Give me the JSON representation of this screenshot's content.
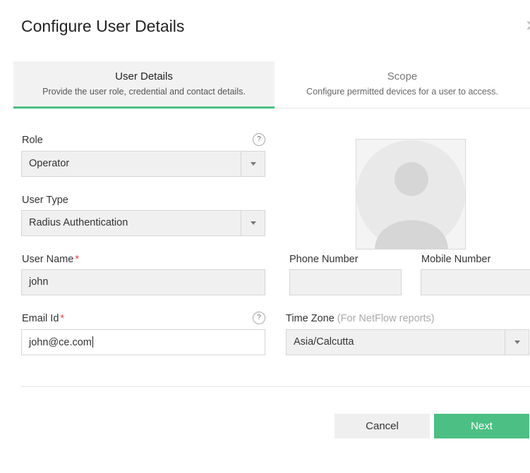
{
  "dialog": {
    "title": "Configure User Details"
  },
  "tabs": [
    {
      "title": "User Details",
      "description": "Provide the user role, credential and contact details.",
      "active": true
    },
    {
      "title": "Scope",
      "description": "Configure permitted devices for a user to access.",
      "active": false
    }
  ],
  "form": {
    "role": {
      "label": "Role",
      "value": "Operator"
    },
    "user_type": {
      "label": "User Type",
      "value": "Radius Authentication"
    },
    "user_name": {
      "label": "User Name",
      "required_mark": "*",
      "value": "john"
    },
    "phone_number": {
      "label": "Phone Number",
      "value": ""
    },
    "mobile_number": {
      "label": "Mobile Number",
      "value": ""
    },
    "email": {
      "label": "Email Id",
      "required_mark": "*",
      "value": "john@ce.com"
    },
    "time_zone": {
      "label": "Time Zone",
      "hint": "(For NetFlow reports)",
      "value": "Asia/Calcutta"
    },
    "help_glyph": "?"
  },
  "buttons": {
    "cancel": "Cancel",
    "next": "Next"
  },
  "colors": {
    "accent": "#4cbf84",
    "required": "#e0474c"
  },
  "icons": {
    "close": "close-icon",
    "help": "help-icon",
    "dropdown": "chevron-down-icon",
    "avatar": "user-avatar-icon"
  }
}
